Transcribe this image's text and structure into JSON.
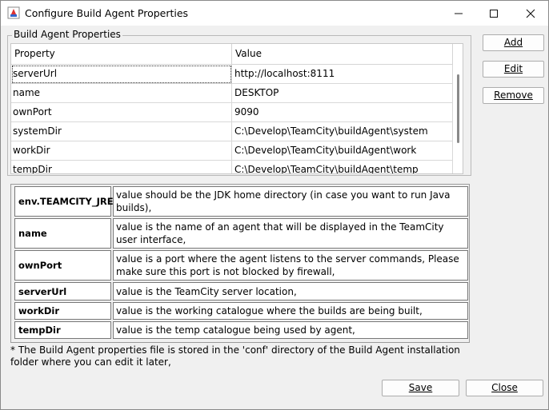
{
  "window": {
    "title": "Configure Build Agent Properties"
  },
  "group": {
    "title": "Build Agent Properties"
  },
  "table": {
    "headers": [
      "Property",
      "Value"
    ],
    "rows": [
      {
        "property": "serverUrl",
        "value": "http://localhost:8111"
      },
      {
        "property": "name",
        "value": "DESKTOP"
      },
      {
        "property": "ownPort",
        "value": "9090"
      },
      {
        "property": "systemDir",
        "value": "C:\\Develop\\TeamCity\\buildAgent\\system"
      },
      {
        "property": "workDir",
        "value": "C:\\Develop\\TeamCity\\buildAgent\\work"
      },
      {
        "property": "tempDir",
        "value": "C:\\Develop\\TeamCity\\buildAgent\\temp"
      }
    ]
  },
  "buttons": {
    "add": "Add",
    "edit": "Edit",
    "remove": "Remove",
    "save": "Save",
    "close": "Close"
  },
  "descriptions": [
    {
      "key": "env.TEAMCITY_JRE",
      "text": "value should be the JDK home directory (in case you want to run Java builds),"
    },
    {
      "key": "name",
      "text": "value is the name of an agent that will be displayed in the TeamCity user interface,"
    },
    {
      "key": "ownPort",
      "text": "value is a port where the agent listens to the server commands, Please make sure this port is not blocked by firewall,"
    },
    {
      "key": "serverUrl",
      "text": "value is the TeamCity server location,"
    },
    {
      "key": "workDir",
      "text": "value is the working catalogue where the builds are being built,"
    },
    {
      "key": "tempDir",
      "text": "value is the temp catalogue being used by agent,"
    }
  ],
  "note": "* The Build Agent properties file is stored in the 'conf' directory of the Build Agent installation folder where you can edit it later,"
}
